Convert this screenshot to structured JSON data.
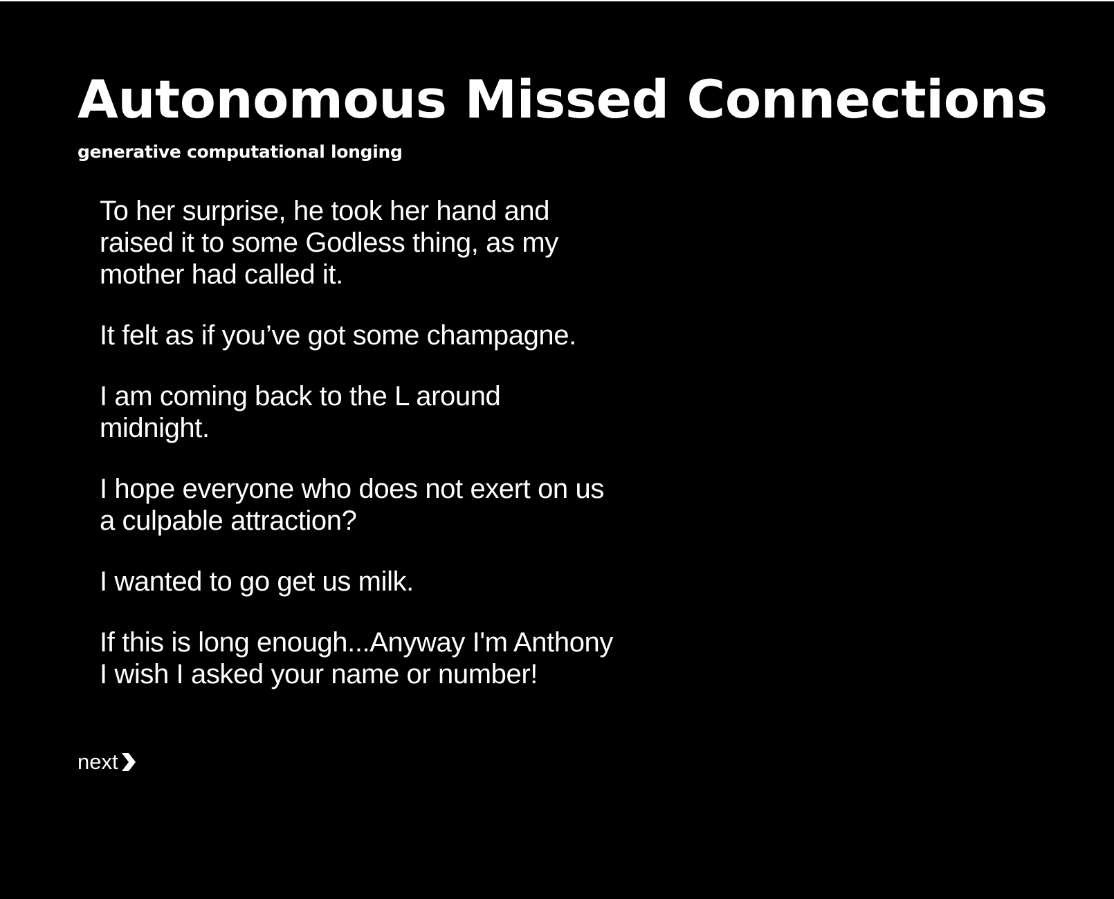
{
  "site": {
    "title": "Autonomous Missed Connections",
    "tagline": "generative computational longing"
  },
  "poem": {
    "stanzas": [
      "To her surprise, he took her hand and\nraised it to some Godless thing, as my\nmother had called it.",
      "It felt as if you’ve got some champagne.",
      "I am coming back to the L around\nmidnight.",
      "I hope everyone who does not exert on us\na culpable attraction?",
      "I wanted to go get us milk.",
      "If this is long enough...Anyway I'm Anthony\nI wish I asked your name or number!"
    ]
  },
  "nav": {
    "next_label": "next",
    "next_icon": "chevron-right-icon"
  },
  "colors": {
    "background": "#000000",
    "text": "#ffffff"
  }
}
